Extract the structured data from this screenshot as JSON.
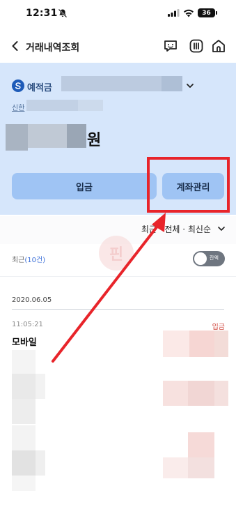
{
  "status_bar": {
    "time": "12:31",
    "battery": "36",
    "icons": [
      "bell-off-icon",
      "signal-icon",
      "wifi-icon",
      "battery-icon"
    ]
  },
  "nav": {
    "title": "거래내역조회",
    "icons": [
      "back-icon",
      "chat-icon",
      "menu-icon",
      "home-icon"
    ]
  },
  "account": {
    "type": "예적금",
    "bank": "신한",
    "currency_unit": "원"
  },
  "buttons": {
    "deposit": "입금",
    "manage": "계좌관리"
  },
  "filter": {
    "text": "최근 · 전체 · 최신순"
  },
  "recent": {
    "label": "최근",
    "count": "(10건)",
    "toggle_label": "잔액"
  },
  "transactions": {
    "date": "2020.06.05",
    "items": [
      {
        "time": "11:05:21",
        "name": "모바일",
        "type": "입금"
      }
    ]
  },
  "watermark": {
    "text": "핀"
  },
  "colors": {
    "panel": "#d6e6fb",
    "button": "#9fc4f4",
    "highlight": "#e8242a",
    "deposit_text": "#d0453c"
  }
}
